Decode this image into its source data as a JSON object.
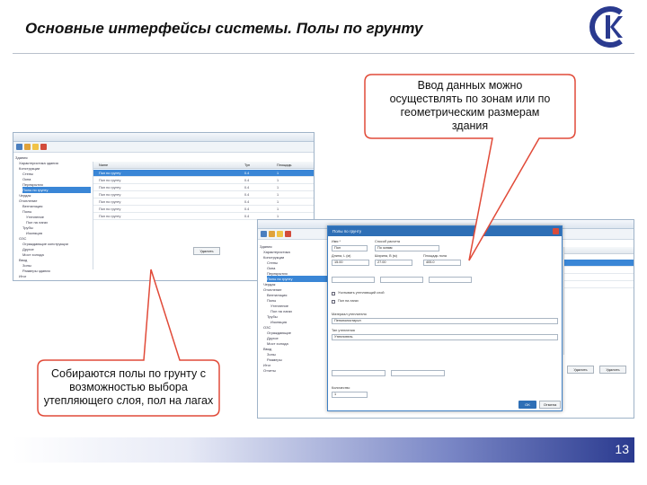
{
  "slide": {
    "title": "Основные интерфейсы системы. Полы по грунту",
    "page_number": "13",
    "callout_top": [
      "Ввод данных можно",
      "осуществлять по зонам или по",
      "геометрическим размерам",
      "здания"
    ],
    "callout_bottom": [
      "Собираются полы по грунту с",
      "возможностью выбора",
      "утепляющего слоя, пол на лагах"
    ]
  },
  "colors": {
    "accent_blue": "#2e6fb6",
    "selection_blue": "#3a86d6",
    "callout_border": "#e14a38",
    "footer_dark": "#2a3a8f"
  },
  "icons": {
    "logo": "company-logo",
    "close": "close-icon",
    "toolbar": [
      "save-icon",
      "user-icon",
      "folder-icon",
      "delete-icon"
    ]
  },
  "window1": {
    "tree_items": [
      "Здания",
      "Характеристика здания",
      "Конструкции",
      "Стены",
      "Окна",
      "Перекрытия",
      "Полы по грунту",
      "Чердак",
      "Отопление",
      "Вентиляция",
      "Полы",
      "Утепление",
      "Пол на лагах",
      "Трубы",
      "Изоляция",
      "ОЗС",
      "Ограждающие конструкции",
      "Другое",
      "Мост холода",
      "Ввод",
      "Зоны",
      "Размеры здания",
      "Итог",
      "Отчеты"
    ],
    "grid_headers": [
      "Name",
      "Туп",
      "Площадь"
    ],
    "grid_rows": [
      [
        "Пол по грунту",
        "0.4",
        "1"
      ],
      [
        "Пол по грунту",
        "0.4",
        "1"
      ],
      [
        "Пол по грунту",
        "0.4",
        "1"
      ],
      [
        "Пол по грунту",
        "0.4",
        "1"
      ],
      [
        "Пол по грунту",
        "0.4",
        "1"
      ],
      [
        "Пол по грунту",
        "0.4",
        "1"
      ],
      [
        "Пол по грунту",
        "0.4",
        "1"
      ]
    ],
    "button": "Удалить"
  },
  "dialog": {
    "title": "Полы по грунту",
    "fields": {
      "name_label": "Имя *",
      "name_value": "Пол",
      "type_label": "Способ расчета",
      "type_value": "По зонам",
      "length_label": "Длина, L (м)",
      "length_value": "15.00",
      "width_label": "Ширина, B (м)",
      "width_value": "27.00",
      "area_label": "Площадь пола",
      "area_value": "405.0"
    },
    "checkbox_1": "Учитывать утепляющий слой",
    "checkbox_2": "Пол на лагах",
    "material_label": "Материал утеплителя",
    "material_value": "Пенополистирол",
    "insulation_label": "Тип утепления",
    "insulation_value": "Утеплитель",
    "count_label": "Количество",
    "count_value": "1",
    "ok": "OK",
    "cancel": "Отмена"
  },
  "window2": {
    "tree_items": [
      "Здания",
      "Характеристика",
      "Конструкции",
      "Стены",
      "Окна",
      "Перекрытия",
      "Полы по грунту",
      "Чердак",
      "Отопление",
      "Вентиляция",
      "Полы",
      "Утепление",
      "Пол на лагах",
      "Трубы",
      "Изоляция",
      "ОЗС",
      "Ограждающие",
      "Другое",
      "Мост холода",
      "Ввод",
      "Зоны",
      "Размеры",
      "Итог",
      "Отчеты"
    ],
    "buttons": [
      "Удалить",
      "Удалить"
    ]
  }
}
